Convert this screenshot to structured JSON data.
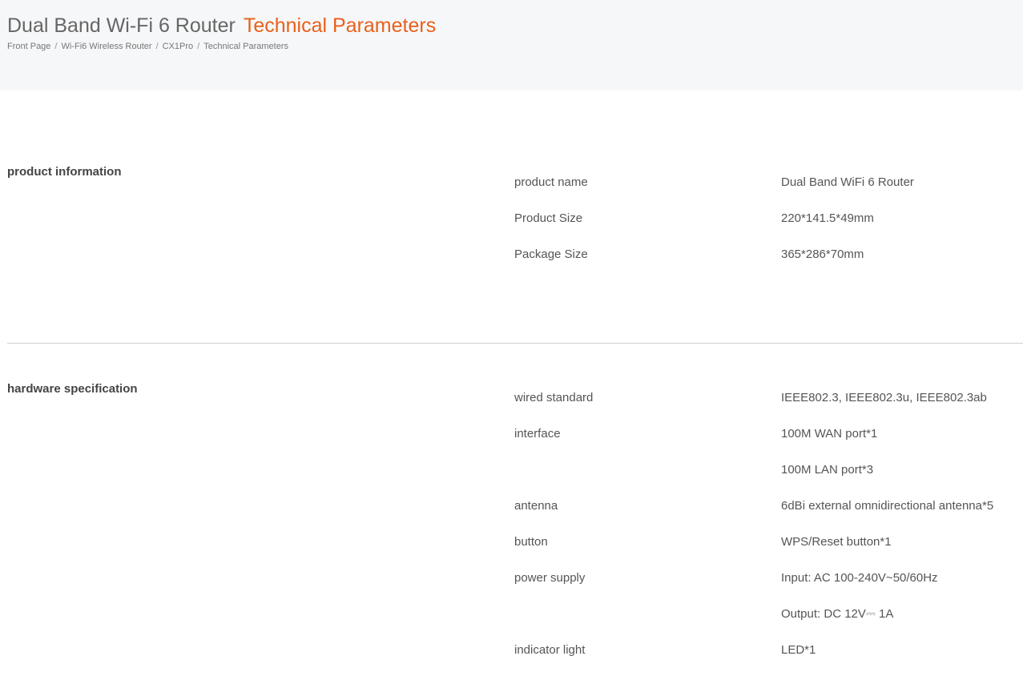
{
  "header": {
    "title_main": "Dual Band Wi-Fi 6 Router",
    "title_accent": "Technical Parameters",
    "breadcrumb": [
      "Front Page",
      "Wi-Fi6 Wireless Router",
      "CX1Pro",
      "Technical Parameters"
    ],
    "breadcrumb_separator": "/"
  },
  "sections": [
    {
      "title": "product information",
      "rows": [
        {
          "label": "product name",
          "value": "Dual Band WiFi 6 Router"
        },
        {
          "label": "Product Size",
          "value": "220*141.5*49mm"
        },
        {
          "label": "Package Size",
          "value": "365*286*70mm"
        }
      ]
    },
    {
      "title": "hardware specification",
      "rows": [
        {
          "label": "wired standard",
          "value": "IEEE802.3, IEEE802.3u, IEEE802.3ab"
        },
        {
          "label": "interface",
          "value": "100M WAN port*1"
        },
        {
          "label": "",
          "value": "100M LAN port*3"
        },
        {
          "label": "antenna",
          "value": "6dBi external omnidirectional antenna*5"
        },
        {
          "label": "button",
          "value": "WPS/Reset button*1"
        },
        {
          "label": "power supply",
          "value": "Input: AC 100-240V~50/60Hz"
        },
        {
          "label": "",
          "value": "Output: DC 12V⎓ 1A"
        },
        {
          "label": "indicator light",
          "value": "LED*1"
        }
      ]
    }
  ],
  "colors": {
    "accent": "#e8601c",
    "header_bg": "#f6f7f8",
    "divider": "#cfcfcf"
  }
}
